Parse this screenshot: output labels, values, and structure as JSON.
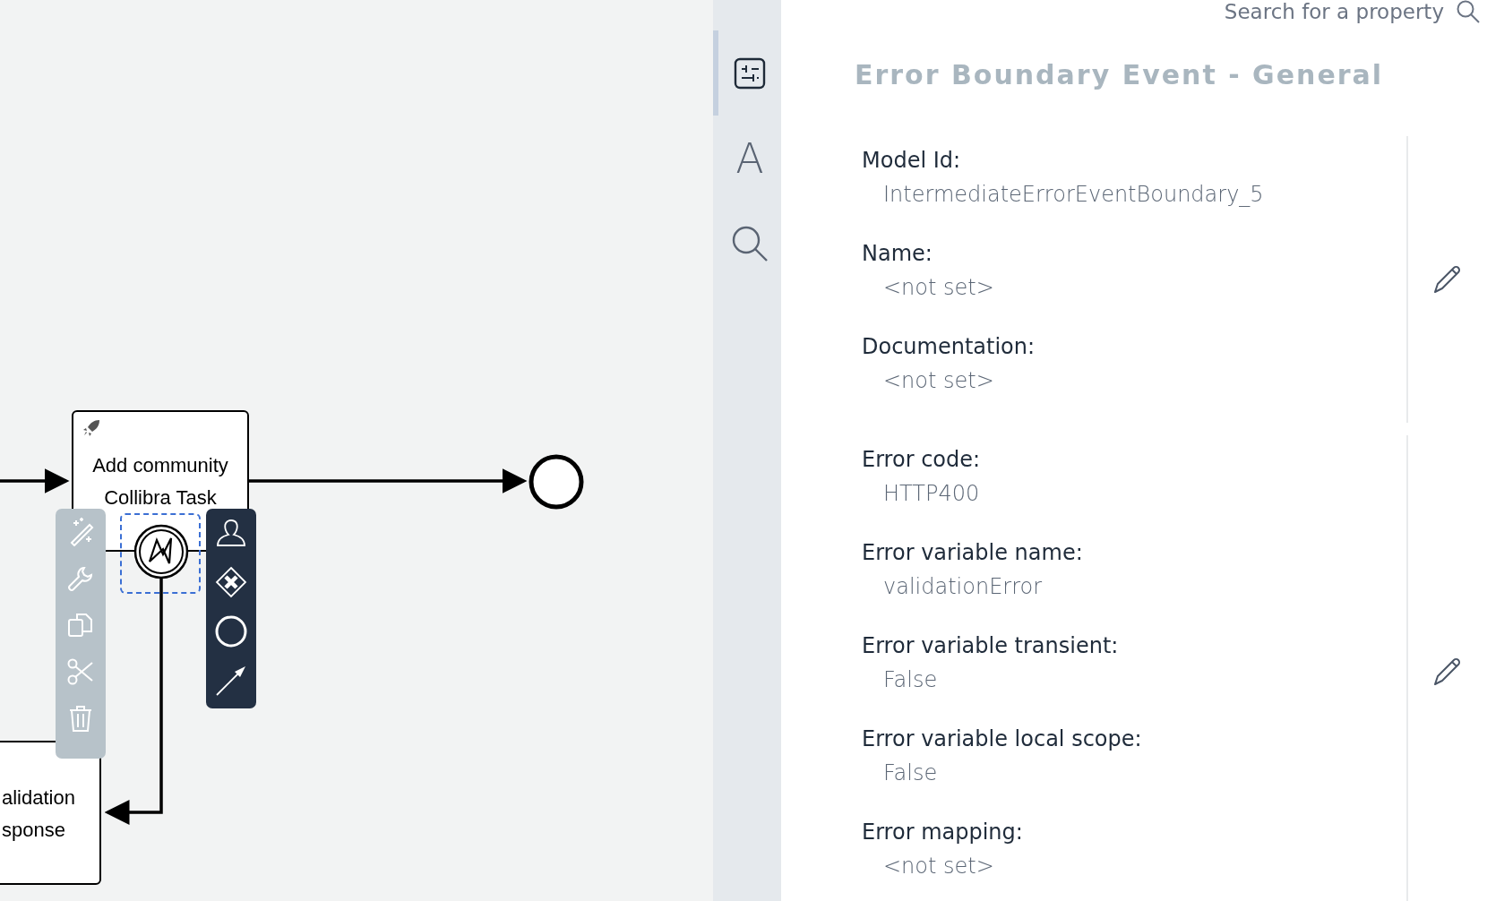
{
  "canvas": {
    "tasks": [
      {
        "kind": "service",
        "lines": [
          "Add community",
          "Collibra Task"
        ]
      },
      {
        "kind": "plain",
        "lines": [
          "alidation",
          "sponse"
        ]
      }
    ]
  },
  "sidebar": {
    "tabs": [
      {
        "kind": "sliders",
        "selected": true
      },
      {
        "kind": "glyph",
        "glyph": "A",
        "selected": false
      },
      {
        "kind": "search",
        "selected": false
      }
    ]
  },
  "panel": {
    "search": {
      "placeholder": "Search for a property"
    },
    "title": "Error Boundary Event - General",
    "sections": [
      {
        "properties": [
          {
            "label": "Model Id:",
            "value": "IntermediateErrorEventBoundary_5"
          },
          {
            "label": "Name:",
            "value": "<not set>"
          },
          {
            "label": "Documentation:",
            "value": "<not set>"
          }
        ]
      },
      {
        "properties": [
          {
            "label": "Error code:",
            "value": "HTTP400"
          },
          {
            "label": "Error variable name:",
            "value": "validationError"
          },
          {
            "label": "Error variable transient:",
            "value": "False"
          },
          {
            "label": "Error variable local scope:",
            "value": "False"
          },
          {
            "label": "Error mapping:",
            "value": "<not set>"
          }
        ]
      }
    ]
  }
}
